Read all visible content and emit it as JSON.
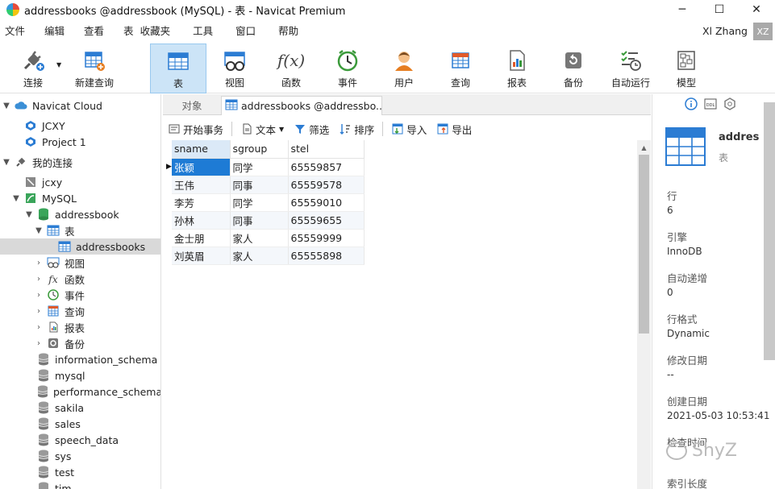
{
  "window": {
    "title": "addressbooks @addressbook (MySQL) - 表 - Navicat Premium",
    "controls": [
      "─",
      "☐",
      "✕"
    ]
  },
  "menu": {
    "items": [
      "文件",
      "编辑",
      "查看",
      "表",
      "收藏夹",
      "工具",
      "窗口",
      "帮助"
    ],
    "user": "Xl Zhang",
    "avatar": "XZ"
  },
  "toolbar": {
    "connect": "连接",
    "new_query": "新建查询",
    "table": "表",
    "view": "视图",
    "function": "函数",
    "event": "事件",
    "user": "用户",
    "query": "查询",
    "report": "报表",
    "backup": "备份",
    "automation": "自动运行",
    "model": "模型"
  },
  "sidebar": {
    "navicat_cloud": "Navicat Cloud",
    "jcxy": "JCXY",
    "project1": "Project 1",
    "my_connections": "我的连接",
    "jcxy_conn": "jcxy",
    "mysql": "MySQL",
    "addressbook": "addressbook",
    "tables": "表",
    "addressbooks": "addressbooks",
    "views": "视图",
    "functions": "函数",
    "events": "事件",
    "queries": "查询",
    "reports": "报表",
    "backups": "备份",
    "db_information_schema": "information_schema",
    "db_mysql": "mysql",
    "db_performance_schema": "performance_schema",
    "db_sakila": "sakila",
    "db_sales": "sales",
    "db_speech_data": "speech_data",
    "db_sys": "sys",
    "db_test": "test",
    "db_tim": "tim"
  },
  "tabs": {
    "objects": "对象",
    "main": "addressbooks @addressbo..."
  },
  "subtoolbar": {
    "begin_tx": "开始事务",
    "text": "文本",
    "filter": "筛选",
    "sort": "排序",
    "import": "导入",
    "export": "导出"
  },
  "grid": {
    "columns": [
      "sname",
      "sgroup",
      "stel"
    ],
    "rows": [
      [
        "张颖",
        "同学",
        "65559857"
      ],
      [
        "王伟",
        "同事",
        "65559578"
      ],
      [
        "李芳",
        "同学",
        "65559010"
      ],
      [
        "孙林",
        "同事",
        "65559655"
      ],
      [
        "金士朋",
        "家人",
        "65559999"
      ],
      [
        "刘英眉",
        "家人",
        "65555898"
      ]
    ]
  },
  "info": {
    "table_name": "addres",
    "table_type": "表",
    "rows_label": "行",
    "rows_value": "6",
    "engine_label": "引擎",
    "engine_value": "InnoDB",
    "autoinc_label": "自动递增",
    "autoinc_value": "0",
    "rowformat_label": "行格式",
    "rowformat_value": "Dynamic",
    "modified_label": "修改日期",
    "modified_value": "--",
    "created_label": "创建日期",
    "created_value": "2021-05-03 10:53:41",
    "checked_label": "检查时间",
    "index_label": "索引长度"
  },
  "watermark": "ShyZ",
  "colors": {
    "accent": "#1e7bd5",
    "toolbar_active": "#cce4f7",
    "table_icon": "#2b7cd3"
  }
}
